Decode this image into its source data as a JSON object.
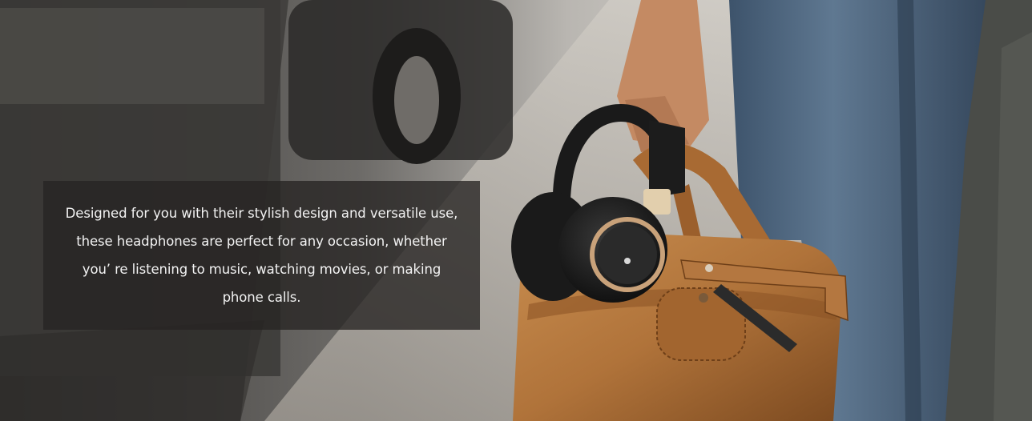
{
  "banner": {
    "caption": "Designed for you with their stylish design and versatile use, these  headphones are perfect for any occasion, whether you’ re listening to music, watching movies, or making phone calls."
  },
  "colors": {
    "leather": "#b77a3e",
    "headphone": "#1e1e1e",
    "accent_gold": "#c9a27a",
    "denim": "#4a6178"
  },
  "icons": [
    "headphones-image",
    "leather-bag-image"
  ]
}
